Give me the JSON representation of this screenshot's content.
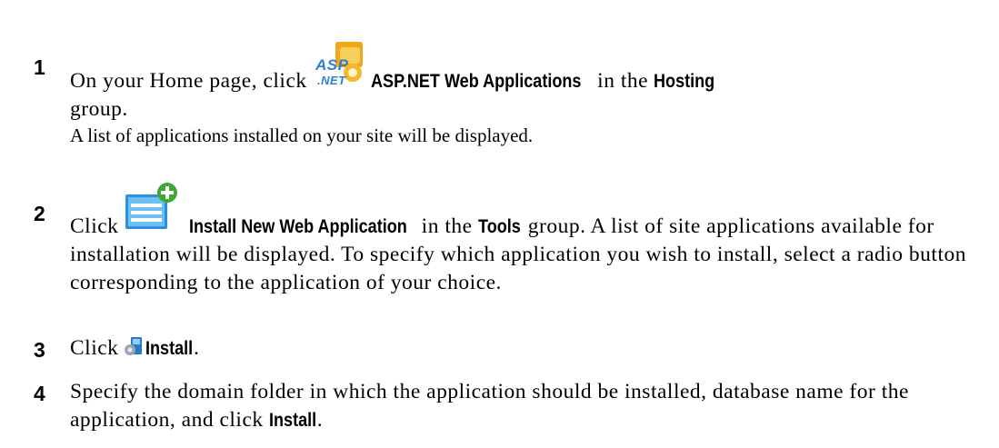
{
  "steps": [
    {
      "number": "1",
      "text_before": "On your Home page, click",
      "ui_label": "ASP.NET Web Applications",
      "text_middle": "in the",
      "ui_label2": "Hosting",
      "text_after": "group.",
      "icon": "aspnet-icon",
      "note": "A list of applications installed on your site will be displayed."
    },
    {
      "number": "2",
      "text_before": "Click",
      "ui_label": "Install New Web Application",
      "text_middle": "in the",
      "ui_label2": "Tools",
      "text_after": "group. A list of site applications available for installation will be displayed. To specify which application you wish to install, select a radio button corresponding to the application of your choice.",
      "icon": "install-new-app-icon"
    },
    {
      "number": "3",
      "text_before": "Click",
      "ui_label": "Install",
      "text_after": ".",
      "icon": "install-icon"
    },
    {
      "number": "4",
      "text_before": "Specify the domain folder in which the application should be installed, database name for the application, and click",
      "ui_label": "Install",
      "text_after": "."
    }
  ],
  "icon_labels": {
    "asp_top": "ASP",
    "asp_bottom": ".NET"
  },
  "colors": {
    "asp_text": "#2f7fd0",
    "folder_yellow": "#f2b01e",
    "plus_green": "#4bb33b",
    "window_blue": "#3d9be0"
  }
}
